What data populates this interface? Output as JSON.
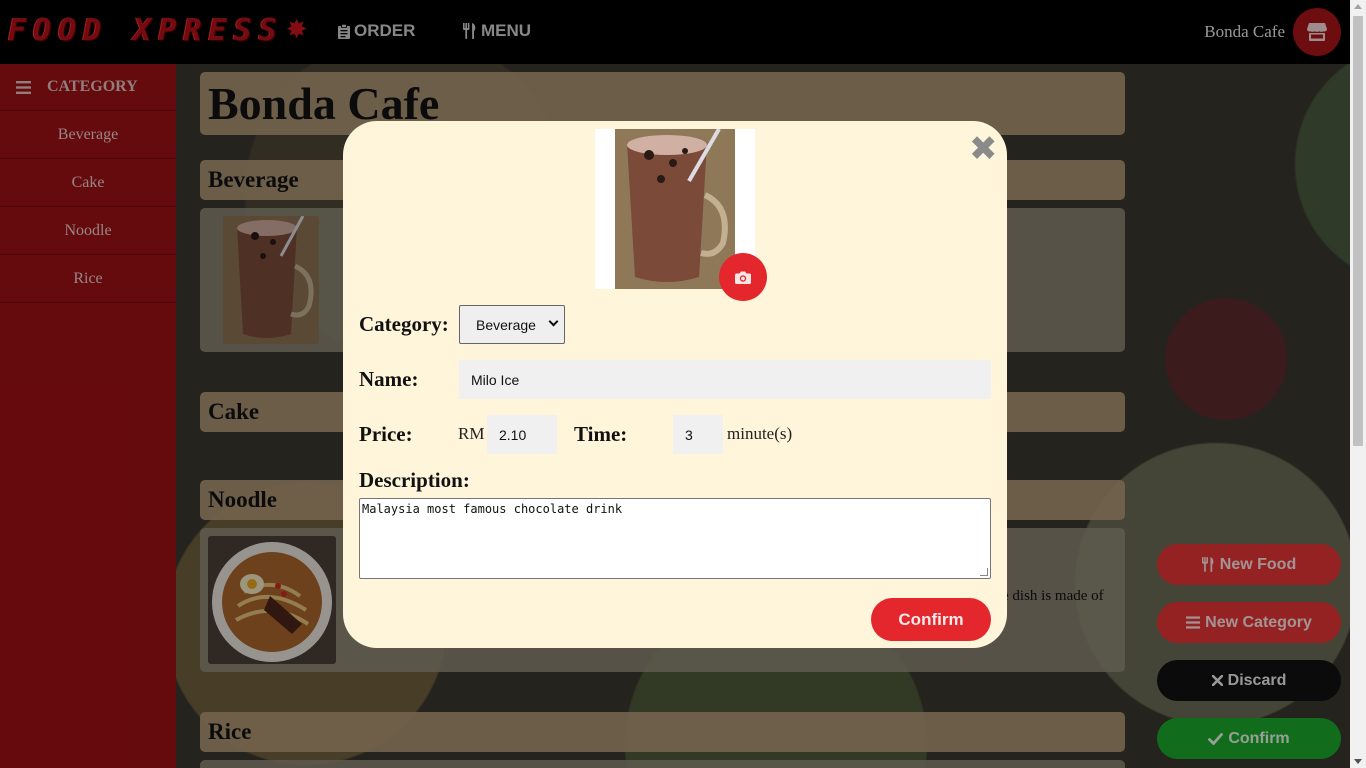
{
  "header": {
    "logo_text": "FOOD XPRESS",
    "nav": {
      "order_label": "ORDER",
      "menu_label": "MENU"
    },
    "store_name": "Bonda Cafe"
  },
  "sidebar": {
    "title": "CATEGORY",
    "items": [
      {
        "label": "Beverage"
      },
      {
        "label": "Cake"
      },
      {
        "label": "Noodle"
      },
      {
        "label": "Rice"
      }
    ]
  },
  "main": {
    "cafe_title": "Bonda Cafe",
    "sections": [
      {
        "title": "Beverage"
      },
      {
        "title": "Cake"
      },
      {
        "title": "Noodle",
        "desc_fragment": "e dish is made of"
      },
      {
        "title": "Rice"
      }
    ]
  },
  "actions": {
    "new_food": "New Food",
    "new_category": "New Category",
    "discard": "Discard",
    "confirm": "Confirm"
  },
  "modal": {
    "close_symbol": "✖",
    "category_label": "Category:",
    "category_value": "Beverage",
    "name_label": "Name:",
    "name_value": "Milo Ice",
    "price_label": "Price:",
    "currency": "RM",
    "price_value": "2.10",
    "time_label": "Time:",
    "time_value": "3",
    "time_unit": "minute(s)",
    "description_label": "Description:",
    "description_value": "Malaysia most famous chocolate drink",
    "confirm_label": "Confirm"
  },
  "colors": {
    "header_bg": "#000000",
    "sidebar_bg": "#9c1014",
    "brand_red": "#e3272d",
    "modal_bg": "#fef5db",
    "discard_bg": "#111111",
    "confirm_green": "#1ba82a"
  },
  "icons": [
    "clipboard-icon",
    "utensils-icon",
    "store-icon",
    "bars-icon",
    "camera-icon",
    "close-icon",
    "times-icon",
    "check-icon"
  ]
}
